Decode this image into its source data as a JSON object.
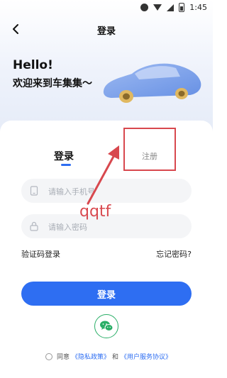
{
  "status_bar": {
    "time": "1:45"
  },
  "nav": {
    "title": "登录"
  },
  "hero": {
    "hello": "Hello!",
    "welcome": "欢迎来到车集集～"
  },
  "tabs": {
    "login": "登录",
    "register": "注册"
  },
  "form": {
    "phone_placeholder": "请输入手机号",
    "password_placeholder": "请输入密码",
    "sms_login": "验证码登录",
    "forgot_password": "忘记密码?",
    "login_button": "登录"
  },
  "agreement": {
    "prefix": "同意",
    "privacy": "《隐私政策》",
    "and": "和",
    "terms": "《用户服务协议》"
  },
  "annotation": {
    "text": "qqtf"
  },
  "colors": {
    "primary": "#2e6ef2",
    "annotation": "#d8484e",
    "wechat": "#2aae67"
  }
}
